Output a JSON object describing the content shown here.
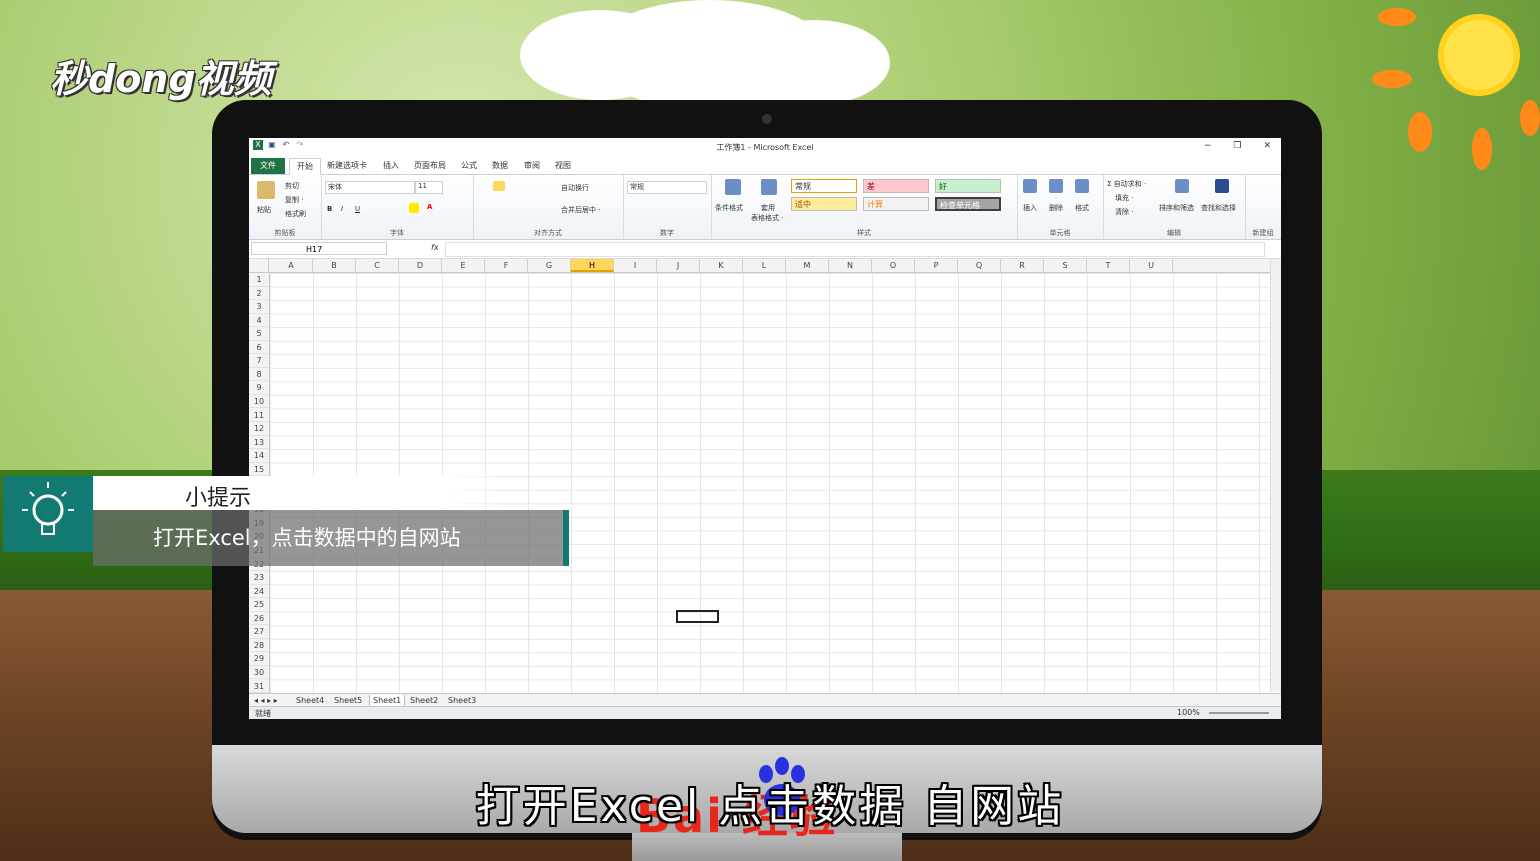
{
  "watermark_logo": "秒dong视频",
  "excel": {
    "window_title": "工作簿1 - Microsoft Excel",
    "window_controls": [
      "−",
      "❐",
      "✕"
    ],
    "tabs": [
      {
        "label": "文件"
      },
      {
        "label": "开始"
      },
      {
        "label": "新建选项卡"
      },
      {
        "label": "插入"
      },
      {
        "label": "页面布局"
      },
      {
        "label": "公式"
      },
      {
        "label": "数据"
      },
      {
        "label": "审阅"
      },
      {
        "label": "视图"
      }
    ],
    "ribbon": {
      "clipboard": {
        "paste": "粘贴",
        "cut": "剪切",
        "copy": "复制 ·",
        "format_painter": "格式刷",
        "group": "剪贴板"
      },
      "font": {
        "font_name": "宋体",
        "font_size": "11",
        "group": "字体"
      },
      "alignment": {
        "wrap": "自动换行",
        "merge": "合并后居中 ·",
        "group": "对齐方式"
      },
      "number": {
        "format": "常规",
        "group": "数字"
      },
      "styles": {
        "conditional": "条件格式",
        "table": "套用",
        "table2": "表格格式 ·",
        "cells": [
          {
            "label": "常规",
            "color": "#ffffff",
            "text": "#333333"
          },
          {
            "label": "差",
            "color": "#ffc7ce",
            "text": "#9c0006"
          },
          {
            "label": "好",
            "color": "#c6efce",
            "text": "#006100"
          },
          {
            "label": "适中",
            "color": "#ffeb9c",
            "text": "#9c5700"
          },
          {
            "label": "计算",
            "color": "#f2f2f2",
            "text": "#fa7d00"
          },
          {
            "label": "检查单元格",
            "color": "#a5a5a5",
            "text": "#ffffff"
          }
        ],
        "group": "样式"
      },
      "cells_group": {
        "insert": "插入",
        "delete": "删除",
        "format": "格式",
        "group": "单元格"
      },
      "editing": {
        "autosum": "Σ 自动求和 ·",
        "fill": "填充 ·",
        "clear": "清除 ·",
        "sort": "排序和筛选",
        "find": "查找和选择",
        "group": "编辑"
      },
      "new_group": "新建组"
    },
    "name_box": "H17",
    "fx": "fx",
    "columns": [
      "A",
      "B",
      "C",
      "D",
      "E",
      "F",
      "G",
      "H",
      "I",
      "J",
      "K",
      "L",
      "M",
      "N",
      "O",
      "P",
      "Q",
      "R",
      "S",
      "T",
      "U"
    ],
    "selected_column": "H",
    "rows": [
      "1",
      "2",
      "3",
      "4",
      "5",
      "6",
      "7",
      "8",
      "9",
      "10",
      "11",
      "12",
      "13",
      "14",
      "15",
      "16",
      "17",
      "18",
      "19",
      "20",
      "21",
      "22",
      "23",
      "24",
      "25",
      "26",
      "27",
      "28",
      "29",
      "30",
      "31"
    ],
    "sheets": [
      "Sheet4",
      "Sheet5",
      "Sheet1",
      "Sheet2",
      "Sheet3"
    ],
    "active_sheet": "Sheet1",
    "status_ready": "就绪",
    "zoom": "100%"
  },
  "tip": {
    "title": "小提示",
    "text": "打开Excel，点击数据中的自网站"
  },
  "baidu_watermark": "Bai  经验",
  "subtitle": "打开Excel 点击数据 自网站"
}
